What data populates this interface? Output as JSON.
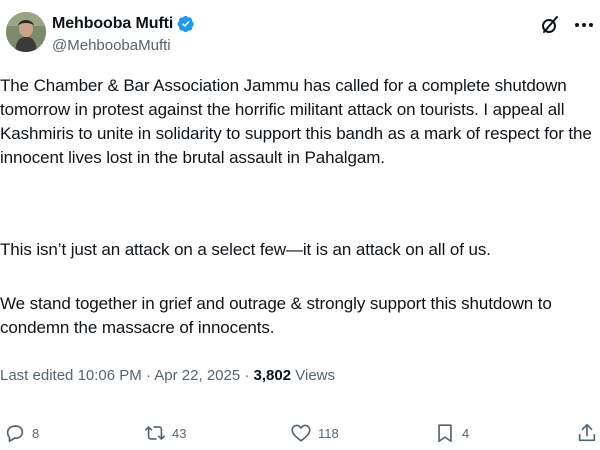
{
  "author": {
    "display_name": "Mehbooba Mufti",
    "handle": "@MehboobaMufti"
  },
  "tweet": {
    "paragraphs": [
      "The Chamber & Bar Association Jammu has called for a complete shutdown tomorrow in protest against the horrific militant attack on tourists. I appeal all Kashmiris to unite in solidarity to support this bandh as a mark of respect for the innocent lives lost in the brutal assault in Pahalgam.",
      "This isn’t just an attack on a select few—it is an attack on all of us.",
      "We stand together in grief and outrage & strongly support this shutdown to condemn the massacre of innocents."
    ]
  },
  "meta": {
    "edited_prefix": "Last edited ",
    "time": "10:06 PM",
    "separator1": " · ",
    "date": "Apr 22, 2025",
    "separator2": " · ",
    "views_count": "3,802",
    "views_label": " Views"
  },
  "actions": {
    "replies": "8",
    "reposts": "43",
    "likes": "118",
    "bookmarks": "4"
  },
  "icons": {
    "verified": "verified-badge-icon",
    "grok": "grok-icon",
    "more": "more-options-icon",
    "reply": "reply-icon",
    "repost": "repost-icon",
    "like": "heart-icon",
    "bookmark": "bookmark-icon",
    "share": "share-icon"
  },
  "colors": {
    "text": "#0f1419",
    "secondary": "#536471",
    "verified": "#1d9bf0"
  }
}
